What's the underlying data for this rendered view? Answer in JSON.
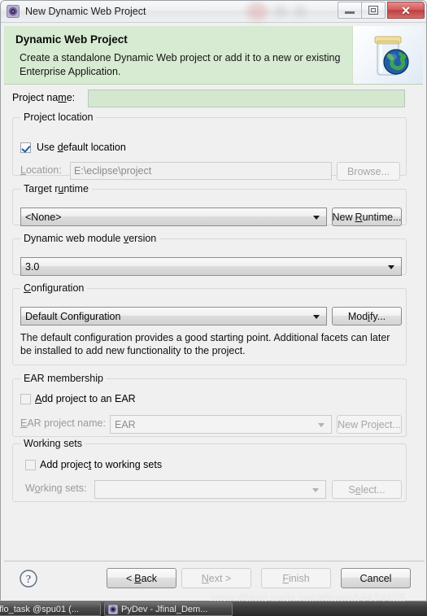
{
  "window": {
    "title": "New Dynamic Web Project",
    "title_ghost": "",
    "icon": "eclipse-wizard-icon",
    "minimize_label": "Minimize",
    "maximize_label": "Maximize",
    "close_label": "✕"
  },
  "banner": {
    "title": "Dynamic Web Project",
    "description": "Create a standalone Dynamic Web project or add it to a new or existing Enterprise Application.",
    "icon": "jar-globe-icon",
    "background_color": "#d7ead2"
  },
  "form": {
    "project_name": {
      "label": "Project name:",
      "value": "",
      "field_color": "#d4e8cf"
    },
    "project_location": {
      "group_title": "Project location",
      "use_default_label": "Use default location",
      "use_default_checked": true,
      "location_label": "Location:",
      "location_value": "E:\\eclipse\\project",
      "browse_label": "Browse..."
    },
    "target_runtime": {
      "group_title": "Target runtime",
      "selected": "<None>",
      "new_runtime_label": "New Runtime..."
    },
    "module_version": {
      "group_title": "Dynamic web module version",
      "selected": "3.0"
    },
    "configuration": {
      "group_title": "Configuration",
      "selected": "Default Configuration",
      "modify_label": "Modify...",
      "description": "The default configuration provides a good starting point. Additional facets can later be installed to add new functionality to the project."
    },
    "ear_membership": {
      "group_title": "EAR membership",
      "add_to_ear_label": "Add project to an EAR",
      "add_to_ear_checked": false,
      "ear_project_name_label": "EAR project name:",
      "ear_project_name_value": "EAR",
      "new_project_label": "New Project..."
    },
    "working_sets": {
      "group_title": "Working sets",
      "add_to_working_sets_label": "Add project to working sets",
      "add_to_working_sets_checked": false,
      "working_sets_label": "Working sets:",
      "working_sets_value": "",
      "select_label": "Select..."
    }
  },
  "buttonbar": {
    "help_icon": "question-mark-icon",
    "back_label": "< Back",
    "next_label": "Next >",
    "finish_label": "Finish",
    "cancel_label": "Cancel",
    "next_disabled": true,
    "finish_disabled": true
  },
  "watermark": {
    "text": "https://blog.csdn.net/jtfjqgtp54474455"
  },
  "taskbar": {
    "items": [
      {
        "label": "flo_task @spu01 (...",
        "icon": ""
      },
      {
        "label": "PyDev - Jfinal_Dem...",
        "icon": "eclipse-icon"
      }
    ]
  }
}
